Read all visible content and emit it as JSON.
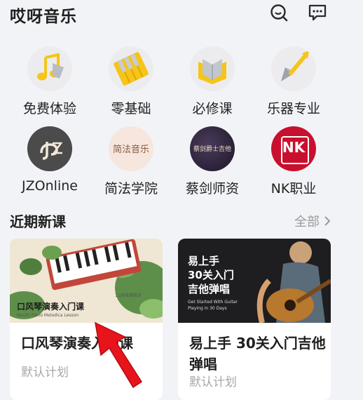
{
  "app": {
    "title": "哎呀音乐"
  },
  "header": {
    "search_icon": "search-icon",
    "message_icon": "message-icon"
  },
  "categories": [
    {
      "label": "免费体验",
      "icon": "music-note-icon"
    },
    {
      "label": "零基础",
      "icon": "piano-keys-icon"
    },
    {
      "label": "必修课",
      "icon": "open-book-icon"
    },
    {
      "label": "乐器专业",
      "icon": "guitar-icon"
    },
    {
      "label": "JZOnline",
      "icon": "jz-logo"
    },
    {
      "label": "简法学院",
      "icon": "jianfa-logo",
      "logo_text": "简法音乐"
    },
    {
      "label": "蔡剑师资",
      "icon": "caijian-logo",
      "logo_text": "蔡剑爵士吉他"
    },
    {
      "label": "NK职业",
      "icon": "nk-logo",
      "logo_text": "NK"
    }
  ],
  "recent": {
    "title": "近期新课",
    "more_label": "全部",
    "courses": [
      {
        "title": "口风琴演奏入门课",
        "subtitle": "默认计划",
        "cover_title": "口风琴演奏入门课",
        "cover_subtitle": "Mouth Piano Melodica Lesson",
        "cover_tag": "11周授课精讲"
      },
      {
        "title": "易上手 30关入门吉他弹唱",
        "subtitle": "默认计划",
        "cover_title_line1": "易上手",
        "cover_title_line2": "30关入门",
        "cover_title_line3": "吉他弹唱",
        "cover_subtitle_line1": "Get Started With Guitar",
        "cover_subtitle_line2": "Playing in 30 Days"
      }
    ]
  },
  "colors": {
    "accent_yellow": "#f5c518",
    "background": "#f2f3f7",
    "arrow_red": "#e8141c"
  }
}
